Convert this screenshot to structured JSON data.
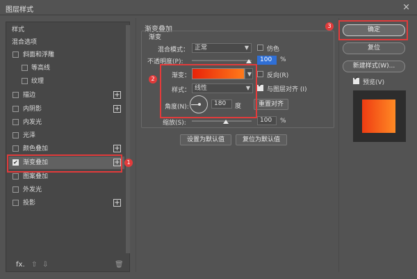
{
  "window": {
    "title": "图层样式",
    "close": "×"
  },
  "left": {
    "items": [
      {
        "label": "样式",
        "check": "none",
        "plus": false,
        "indent": 0
      },
      {
        "label": "混合选项",
        "check": "none",
        "plus": false,
        "indent": 0
      },
      {
        "label": "斜面和浮雕",
        "check": "off",
        "plus": false,
        "indent": 0
      },
      {
        "label": "等高线",
        "check": "off",
        "plus": false,
        "indent": 1
      },
      {
        "label": "纹理",
        "check": "off",
        "plus": false,
        "indent": 1
      },
      {
        "label": "描边",
        "check": "off",
        "plus": true,
        "indent": 0
      },
      {
        "label": "内阴影",
        "check": "off",
        "plus": true,
        "indent": 0
      },
      {
        "label": "内发光",
        "check": "off",
        "plus": false,
        "indent": 0
      },
      {
        "label": "光泽",
        "check": "off",
        "plus": false,
        "indent": 0
      },
      {
        "label": "颜色叠加",
        "check": "off",
        "plus": true,
        "indent": 0
      },
      {
        "label": "渐变叠加",
        "check": "on",
        "plus": true,
        "indent": 0
      },
      {
        "label": "图案叠加",
        "check": "off",
        "plus": false,
        "indent": 0
      },
      {
        "label": "外发光",
        "check": "off",
        "plus": false,
        "indent": 0
      },
      {
        "label": "投影",
        "check": "off",
        "plus": true,
        "indent": 0
      }
    ],
    "fx_label": "fx.",
    "up_icon": "⇧",
    "down_icon": "⇩",
    "trash_icon": "🗑"
  },
  "main": {
    "section_title": "渐变叠加",
    "subsection_title": "渐变",
    "blend_mode_label": "混合模式：",
    "blend_mode_value": "正常",
    "dither_label": "仿色",
    "opacity_label": "不透明度(P):",
    "opacity_value": "100",
    "percent": "%",
    "gradient_label": "渐变：",
    "reverse_label": "反向(R)",
    "style_label": "样式：",
    "style_value": "线性",
    "align_label": "与图层对齐 (I)",
    "angle_label": "角度(N):",
    "angle_value": "180",
    "degree_unit": "度",
    "reset_align_label": "重置对齐",
    "scale_label": "缩放(S):",
    "scale_value": "100",
    "set_default_label": "设置为默认值",
    "reset_default_label": "复位为默认值"
  },
  "right": {
    "ok_label": "确定",
    "reset_label": "复位",
    "new_style_label": "新建样式(W)...",
    "preview_label": "预览(V)"
  },
  "badges": {
    "b1": "1",
    "b2": "2",
    "b3": "3"
  },
  "colors": {
    "accent_red": "#e23b3b",
    "gradient_start": "#e8230a",
    "gradient_end": "#ff7a1a",
    "selection_blue": "#2f6fd6"
  }
}
